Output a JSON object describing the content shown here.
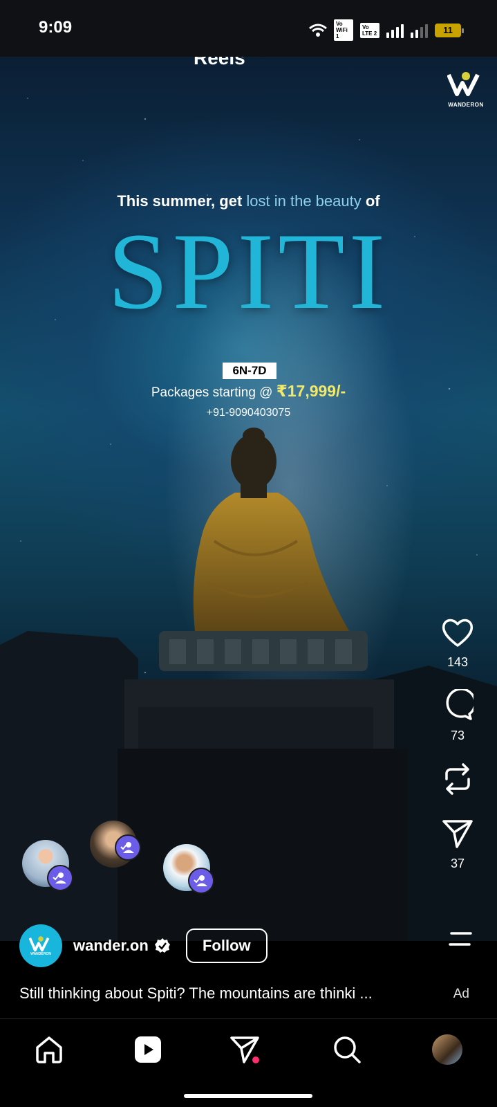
{
  "status_bar": {
    "time": "9:09",
    "sim1_tag": "Vo WiFi",
    "sim1_num": "1",
    "sim2_tag": "Vo LTE",
    "sim2_num": "2",
    "battery": "11"
  },
  "reel": {
    "tab_title": "Reels",
    "brand_logo_text": "WANDERON",
    "headline_part1": "This summer, get ",
    "headline_highlight": "lost in the beauty",
    "headline_part2": " of",
    "destination": "SPITI",
    "duration": "6N-7D",
    "package_label": "Packages starting @ ",
    "package_price": "₹17,999/-",
    "phone": "+91-9090403075"
  },
  "actions": {
    "like_count": "143",
    "comment_count": "73",
    "share_count": "37"
  },
  "post": {
    "author": "wander.on",
    "author_avatar_text": "WANDERON",
    "follow_label": "Follow",
    "caption": "Still thinking about Spiti? The mountains are thinki ...",
    "ad_label": "Ad"
  },
  "colors": {
    "accent_spiti": "#21b6d8",
    "highlight_text": "#8fd1ec",
    "price": "#f2e96a",
    "badge": "#6b5de8",
    "notification_dot": "#ff2e6e"
  }
}
